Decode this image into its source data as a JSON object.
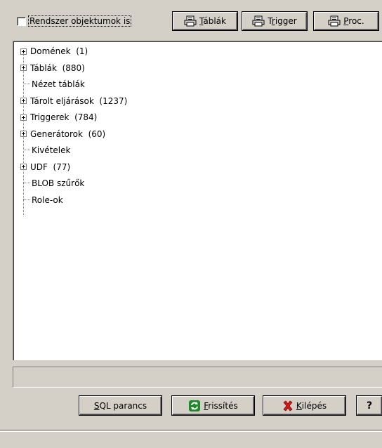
{
  "header": {
    "system_objects_label": "Rendszer objektumok is",
    "system_objects_checked": false,
    "tables_button": "Táblák",
    "tables_button_mnemonic": "T",
    "trigger_button": "Trigger",
    "trigger_button_mnemonic": "r",
    "proc_button": "Proc.",
    "proc_button_mnemonic": "P"
  },
  "tree": {
    "items": [
      {
        "label": "Domének  (1)",
        "expandable": true
      },
      {
        "label": "Táblák  (880)",
        "expandable": true
      },
      {
        "label": "Nézet táblák",
        "expandable": false
      },
      {
        "label": "Tárolt eljárások  (1237)",
        "expandable": true
      },
      {
        "label": "Triggerek  (784)",
        "expandable": true
      },
      {
        "label": "Generátorok  (60)",
        "expandable": true
      },
      {
        "label": "Kivételek",
        "expandable": false
      },
      {
        "label": "UDF  (77)",
        "expandable": true
      },
      {
        "label": "BLOB szűrők",
        "expandable": false
      },
      {
        "label": "Role-ok",
        "expandable": false
      }
    ]
  },
  "status": {
    "text": ""
  },
  "footer": {
    "sql_button": "SQL parancs",
    "sql_mnemonic": "S",
    "refresh_button": "Frissítés",
    "refresh_mnemonic": "F",
    "exit_button": "Kilépés",
    "exit_mnemonic": "K",
    "help_button": "?"
  },
  "colors": {
    "window_bg": "#d4d0c8",
    "tree_bg": "#ffffff",
    "refresh_icon": "#1f8a2a",
    "exit_icon": "#d21a1a"
  },
  "icons": {
    "print": "printer-icon",
    "refresh": "refresh-icon",
    "exit": "x-mark-icon"
  }
}
